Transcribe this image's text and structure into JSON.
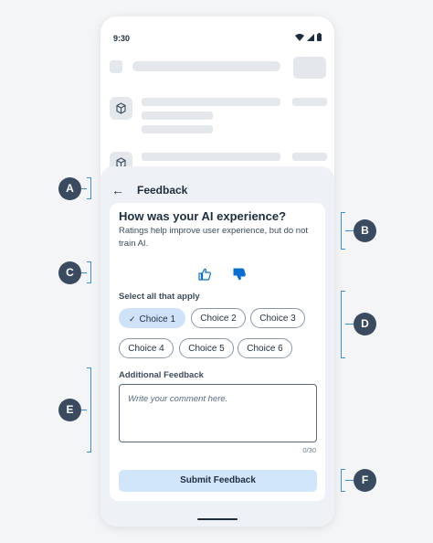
{
  "status_bar": {
    "time": "9:30"
  },
  "sheet": {
    "title": "Feedback"
  },
  "question": {
    "title": "How was your AI experience?",
    "subtitle": "Ratings help improve user experience, but do not train AI."
  },
  "select_label": "Select all that apply",
  "choices": [
    {
      "label": "Choice 1",
      "selected": true
    },
    {
      "label": "Choice 2",
      "selected": false
    },
    {
      "label": "Choice 3",
      "selected": false
    },
    {
      "label": "Choice 4",
      "selected": false
    },
    {
      "label": "Choice 5",
      "selected": false
    },
    {
      "label": "Choice 6",
      "selected": false
    }
  ],
  "additional": {
    "label": "Additional Feedback",
    "placeholder": "Write your comment here.",
    "counter": "0/30"
  },
  "submit_label": "Submit Feedback",
  "markers": [
    "A",
    "B",
    "C",
    "D",
    "E",
    "F"
  ],
  "colors": {
    "accent": "#3b8de0",
    "selected_chip": "#cfe2f7",
    "marker": "#3a4b60",
    "thumbs_down_fill": "#0a6ed1"
  }
}
